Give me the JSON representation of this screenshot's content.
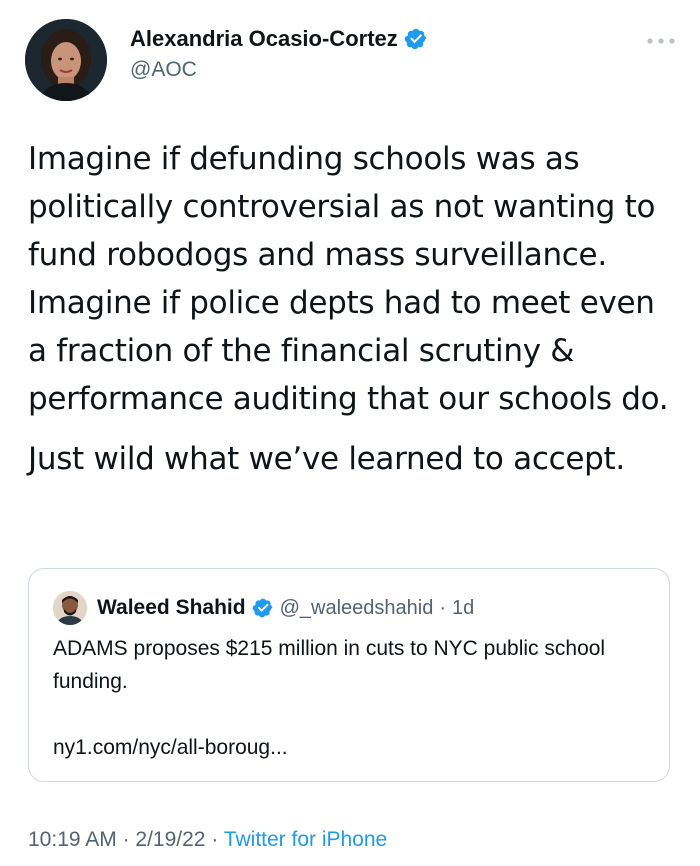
{
  "author": {
    "name": "Alexandria Ocasio-Cortez",
    "handle": "@AOC",
    "verified_icon": "verified-badge-icon",
    "avatar_icon": "avatar-photo"
  },
  "more_icon": "more-horizontal-icon",
  "tweet": {
    "paragraphs": [
      "Imagine if defunding schools was as politically controversial as not wanting to fund robodogs and mass surveillance. Imagine if police depts had to meet even a fraction of the financial scrutiny & performance auditing that our schools do.",
      "Just wild what we’ve learned to accept."
    ]
  },
  "quote": {
    "name": "Waleed Shahid",
    "handle": "@_waleedshahid",
    "separator": "·",
    "time": "1d",
    "text": "ADAMS proposes $215 million in cuts to NYC public school funding.",
    "link": "ny1.com/nyc/all-boroug..."
  },
  "meta": {
    "time": "10:19 AM",
    "separator": "·",
    "date": "2/19/22",
    "source": "Twitter for iPhone"
  },
  "colors": {
    "verified_blue": "#1d9bf0",
    "link_blue": "#1d9bf0",
    "secondary_text": "#536471",
    "primary_text": "#0f1419",
    "border": "#cfd9de"
  }
}
